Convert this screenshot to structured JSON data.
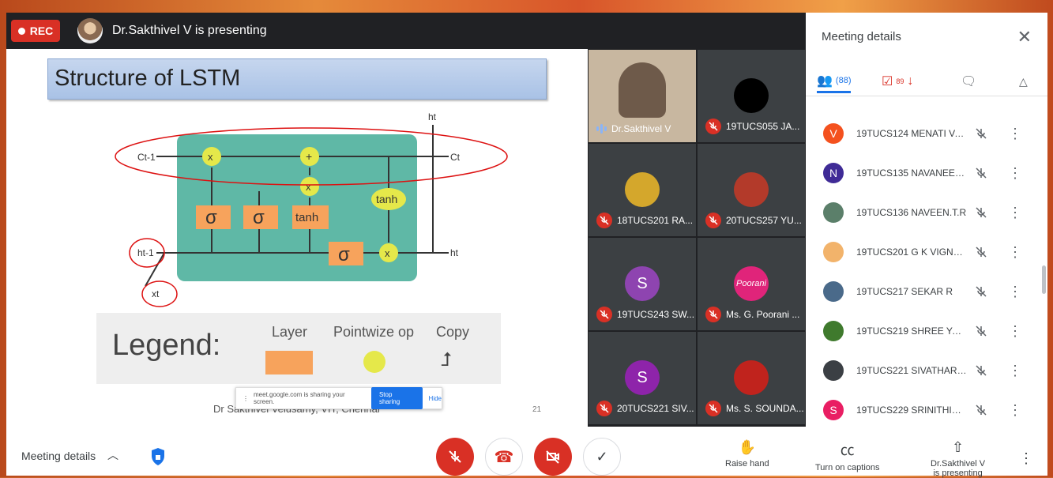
{
  "top": {
    "rec_label": "REC",
    "presenting": "Dr.Sakthivel V is presenting"
  },
  "slide": {
    "title": "Structure of LSTM",
    "diagram": {
      "c_prev": "Ct-1",
      "c_next": "Ct",
      "h_out_top": "ht",
      "h_prev": "ht-1",
      "h_out": "ht",
      "x_in": "xt",
      "sigma": "σ",
      "tanh": "tanh",
      "mult": "x",
      "plus": "+"
    },
    "legend": {
      "title": "Legend:",
      "layer": "Layer",
      "pointwise": "Pointwize op",
      "copy": "Copy"
    },
    "footer": "Dr Sakthivel Velusamy, VIT, Chennai",
    "page": "21",
    "share_bar": {
      "text": "meet.google.com is sharing your screen.",
      "stop": "Stop sharing",
      "hide": "Hide"
    }
  },
  "tiles": [
    {
      "name": "Dr.Sakthivel V",
      "muted": false,
      "avatar_color": "#000000",
      "initial": ""
    },
    {
      "name": "19TUCS055 JA...",
      "muted": true,
      "avatar_color": "#000000",
      "initial": ""
    },
    {
      "name": "18TUCS201 RA...",
      "muted": true,
      "avatar_color": "#d4a72c",
      "initial": ""
    },
    {
      "name": "20TUCS257 YU...",
      "muted": true,
      "avatar_color": "#b33a2a",
      "initial": ""
    },
    {
      "name": "19TUCS243 SW...",
      "muted": true,
      "avatar_color": "#8e44b0",
      "initial": "S"
    },
    {
      "name": "Ms. G. Poorani ...",
      "muted": true,
      "avatar_color": "#e0247a",
      "initial": "Poorani"
    },
    {
      "name": "20TUCS221 SIV...",
      "muted": true,
      "avatar_color": "#8e24aa",
      "initial": "S"
    },
    {
      "name": "Ms. S. SOUNDA...",
      "muted": true,
      "avatar_color": "#c0231d",
      "initial": ""
    }
  ],
  "panel": {
    "title": "Meeting details",
    "people_count": "(88)",
    "tasks_count": "89",
    "participants": [
      {
        "name": "19TUCS124 MENATI VAS...",
        "initial": "V",
        "color": "#f4511e"
      },
      {
        "name": "19TUCS135 NAVANEETH...",
        "initial": "N",
        "color": "#3f2b96"
      },
      {
        "name": "19TUCS136 NAVEEN.T.R",
        "initial": "",
        "color": "#5b7f6a"
      },
      {
        "name": "19TUCS201 G K VIGNESH",
        "initial": "",
        "color": "#f2b36b"
      },
      {
        "name": "19TUCS217 SEKAR R",
        "initial": "",
        "color": "#4a6a8a"
      },
      {
        "name": "19TUCS219 SHREE YAZH...",
        "initial": "",
        "color": "#3f7a2d"
      },
      {
        "name": "19TUCS221 SIVATHARS...",
        "initial": "",
        "color": "#3b3f44"
      },
      {
        "name": "19TUCS229 SRINITHISH.U",
        "initial": "S",
        "color": "#e91e63"
      }
    ]
  },
  "bottom": {
    "meeting_details": "Meeting details",
    "raise_hand": "Raise hand",
    "captions": "Turn on captions",
    "presenting_line1": "Dr.Sakthivel V",
    "presenting_line2": "is presenting"
  }
}
